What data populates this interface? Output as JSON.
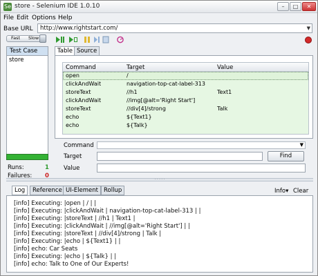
{
  "window": {
    "title": "store - Selenium IDE 1.0.10",
    "minimize_glyph": "–",
    "maximize_glyph": "□",
    "close_glyph": "✕"
  },
  "menu": [
    {
      "label": "File",
      "mnemonic": "F"
    },
    {
      "label": "Edit",
      "mnemonic": "E"
    },
    {
      "label": "Options",
      "mnemonic": "O"
    },
    {
      "label": "Help",
      "mnemonic": "H"
    }
  ],
  "base_url": {
    "label": "Base URL",
    "value": "http://www.rightstart.com/"
  },
  "toolbar": {
    "speed_fast": "Fast",
    "speed_slow": "Slow",
    "icons": [
      "play-all-icon",
      "play-current-icon",
      "pause-icon",
      "step-icon",
      "rollup-icon",
      "schedule-icon",
      "record-icon"
    ]
  },
  "test_panel": {
    "header": "Test Case",
    "items": [
      "store"
    ],
    "runs_label": "Runs:",
    "runs": "1",
    "failures_label": "Failures:",
    "failures": "0",
    "pass_color": "#34b234"
  },
  "editor_tabs": [
    "Table",
    "Source"
  ],
  "table": {
    "headers": [
      "Command",
      "Target",
      "Value"
    ],
    "rows": [
      {
        "command": "open",
        "target": "/",
        "value": ""
      },
      {
        "command": "clickAndWait",
        "target": "navigation-top-cat-label-313",
        "value": ""
      },
      {
        "command": "storeText",
        "target": "//h1",
        "value": "Text1"
      },
      {
        "command": "clickAndWait",
        "target": "//img[@alt='Right Start']",
        "value": ""
      },
      {
        "command": "storeText",
        "target": "//div[4]/strong",
        "value": "Talk"
      },
      {
        "command": "echo",
        "target": "${Text1}",
        "value": ""
      },
      {
        "command": "echo",
        "target": "${Talk}",
        "value": ""
      }
    ],
    "row_color": "#e6f7e3"
  },
  "edit": {
    "command_label": "Command",
    "target_label": "Target",
    "value_label": "Value",
    "find_label": "Find"
  },
  "bottom_tabs": [
    "Log",
    "Reference",
    "UI-Element",
    "Rollup"
  ],
  "log_controls": {
    "info": "Info",
    "clear": "Clear"
  },
  "log": [
    "[info] Executing: |open | / | |",
    "[info] Executing: |clickAndWait | navigation-top-cat-label-313 | |",
    "[info] Executing: |storeText | //h1 | Text1 |",
    "[info] Executing: |clickAndWait | //img[@alt='Right Start'] | |",
    "[info] Executing: |storeText | //div[4]/strong | Talk |",
    "[info] Executing: |echo | ${Text1} | |",
    "[info] echo: Car Seats",
    "[info] Executing: |echo | ${Talk} | |",
    "[info] echo: Talk to One of Our Experts!"
  ]
}
